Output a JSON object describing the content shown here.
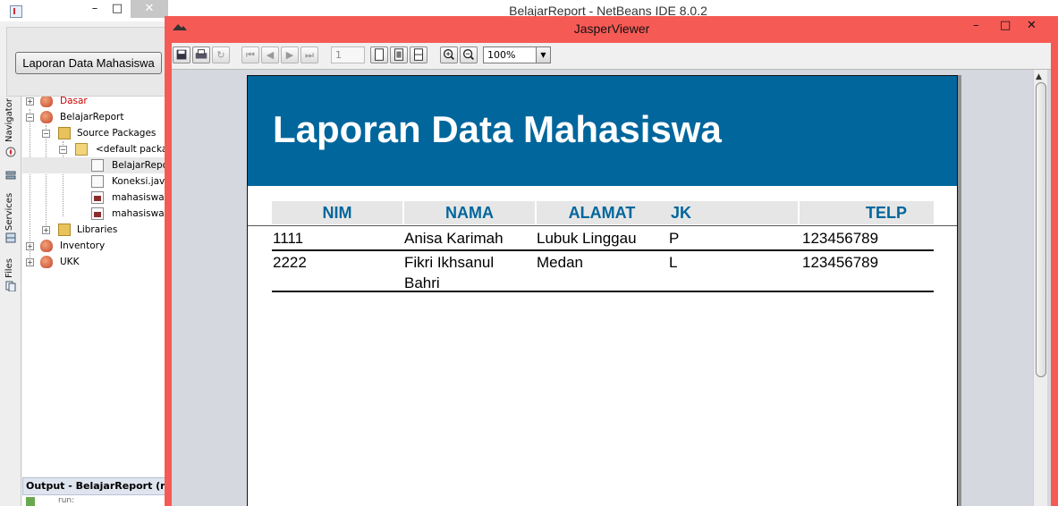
{
  "netbeans": {
    "title": "BelajarReport - NetBeans IDE 8.0.2",
    "minimize": "–",
    "maximize": "□",
    "close": "✕"
  },
  "jframe": {
    "button_label": "Laporan Data Mahasiswa"
  },
  "side_tabs": [
    "Navigator",
    "Services",
    "Files"
  ],
  "tree": [
    {
      "label": "Dasar",
      "icon": "project-icon",
      "color": "#cc0000"
    },
    {
      "label": "BelajarReport",
      "icon": "project-icon"
    },
    {
      "label": "Source Packages",
      "icon": "folder-icon"
    },
    {
      "label": "<default package>",
      "icon": "package-icon"
    },
    {
      "label": "BelajarReport.java",
      "icon": "java-file-icon"
    },
    {
      "label": "Koneksi.java",
      "icon": "java-file-icon"
    },
    {
      "label": "mahasiswa.jasper",
      "icon": "jasper-file-icon"
    },
    {
      "label": "mahasiswa.jrxml",
      "icon": "jrxml-file-icon"
    },
    {
      "label": "Libraries",
      "icon": "library-icon"
    },
    {
      "label": "Inventory",
      "icon": "project-icon"
    },
    {
      "label": "UKK",
      "icon": "project-icon"
    }
  ],
  "output": {
    "title": "Output - BelajarReport (run)",
    "line": "run:"
  },
  "jasper": {
    "title": "JasperViewer",
    "minimize": "–",
    "maximize": "□",
    "close": "✕",
    "toolbar": {
      "page_number": "1",
      "zoom": "100%"
    },
    "report": {
      "title": "Laporan Data Mahasiswa",
      "columns": [
        "NIM",
        "NAMA",
        "ALAMAT",
        "JK",
        "TELP"
      ],
      "rows": [
        {
          "nim": "1111",
          "nama": "Anisa Karimah",
          "alamat": "Lubuk Linggau",
          "jk": "P",
          "telp": "123456789"
        },
        {
          "nim": "2222",
          "nama": "Fikri Ikhsanul Bahri",
          "alamat": "Medan",
          "jk": "L",
          "telp": "123456789"
        }
      ]
    }
  },
  "colors": {
    "jasper_frame": "#f65a55",
    "report_header": "#00669c",
    "column_header_text": "#00669c"
  }
}
